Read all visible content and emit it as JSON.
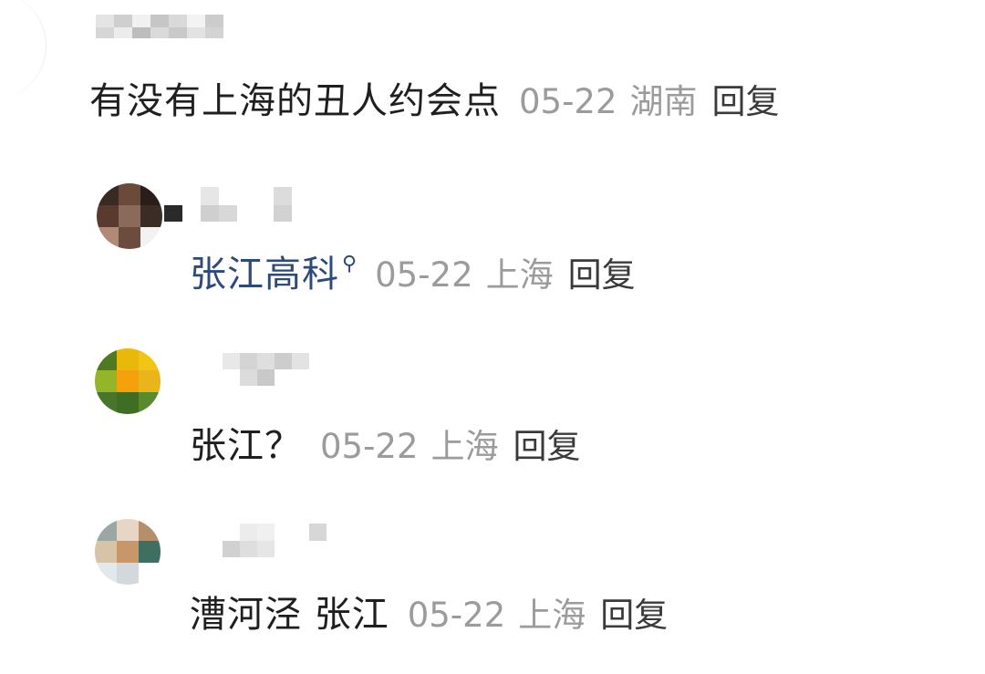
{
  "top_comment": {
    "text": "有没有上海的丑人约会点",
    "date": "05-22",
    "location": "湖南",
    "reply_label": "回复"
  },
  "replies": [
    {
      "text": "张江高科",
      "has_search_link": true,
      "date": "05-22",
      "location": "上海",
      "reply_label": "回复"
    },
    {
      "text": "张江？",
      "date": "05-22",
      "location": "上海",
      "reply_label": "回复"
    },
    {
      "text": "漕河泾 张江",
      "date": "05-22",
      "location": "上海",
      "reply_label": "回复"
    }
  ],
  "icons": {
    "search_link": "search-icon"
  },
  "colors": {
    "link": "#2d4a7c",
    "meta": "#9b9b9b",
    "text": "#1f1f1f"
  }
}
